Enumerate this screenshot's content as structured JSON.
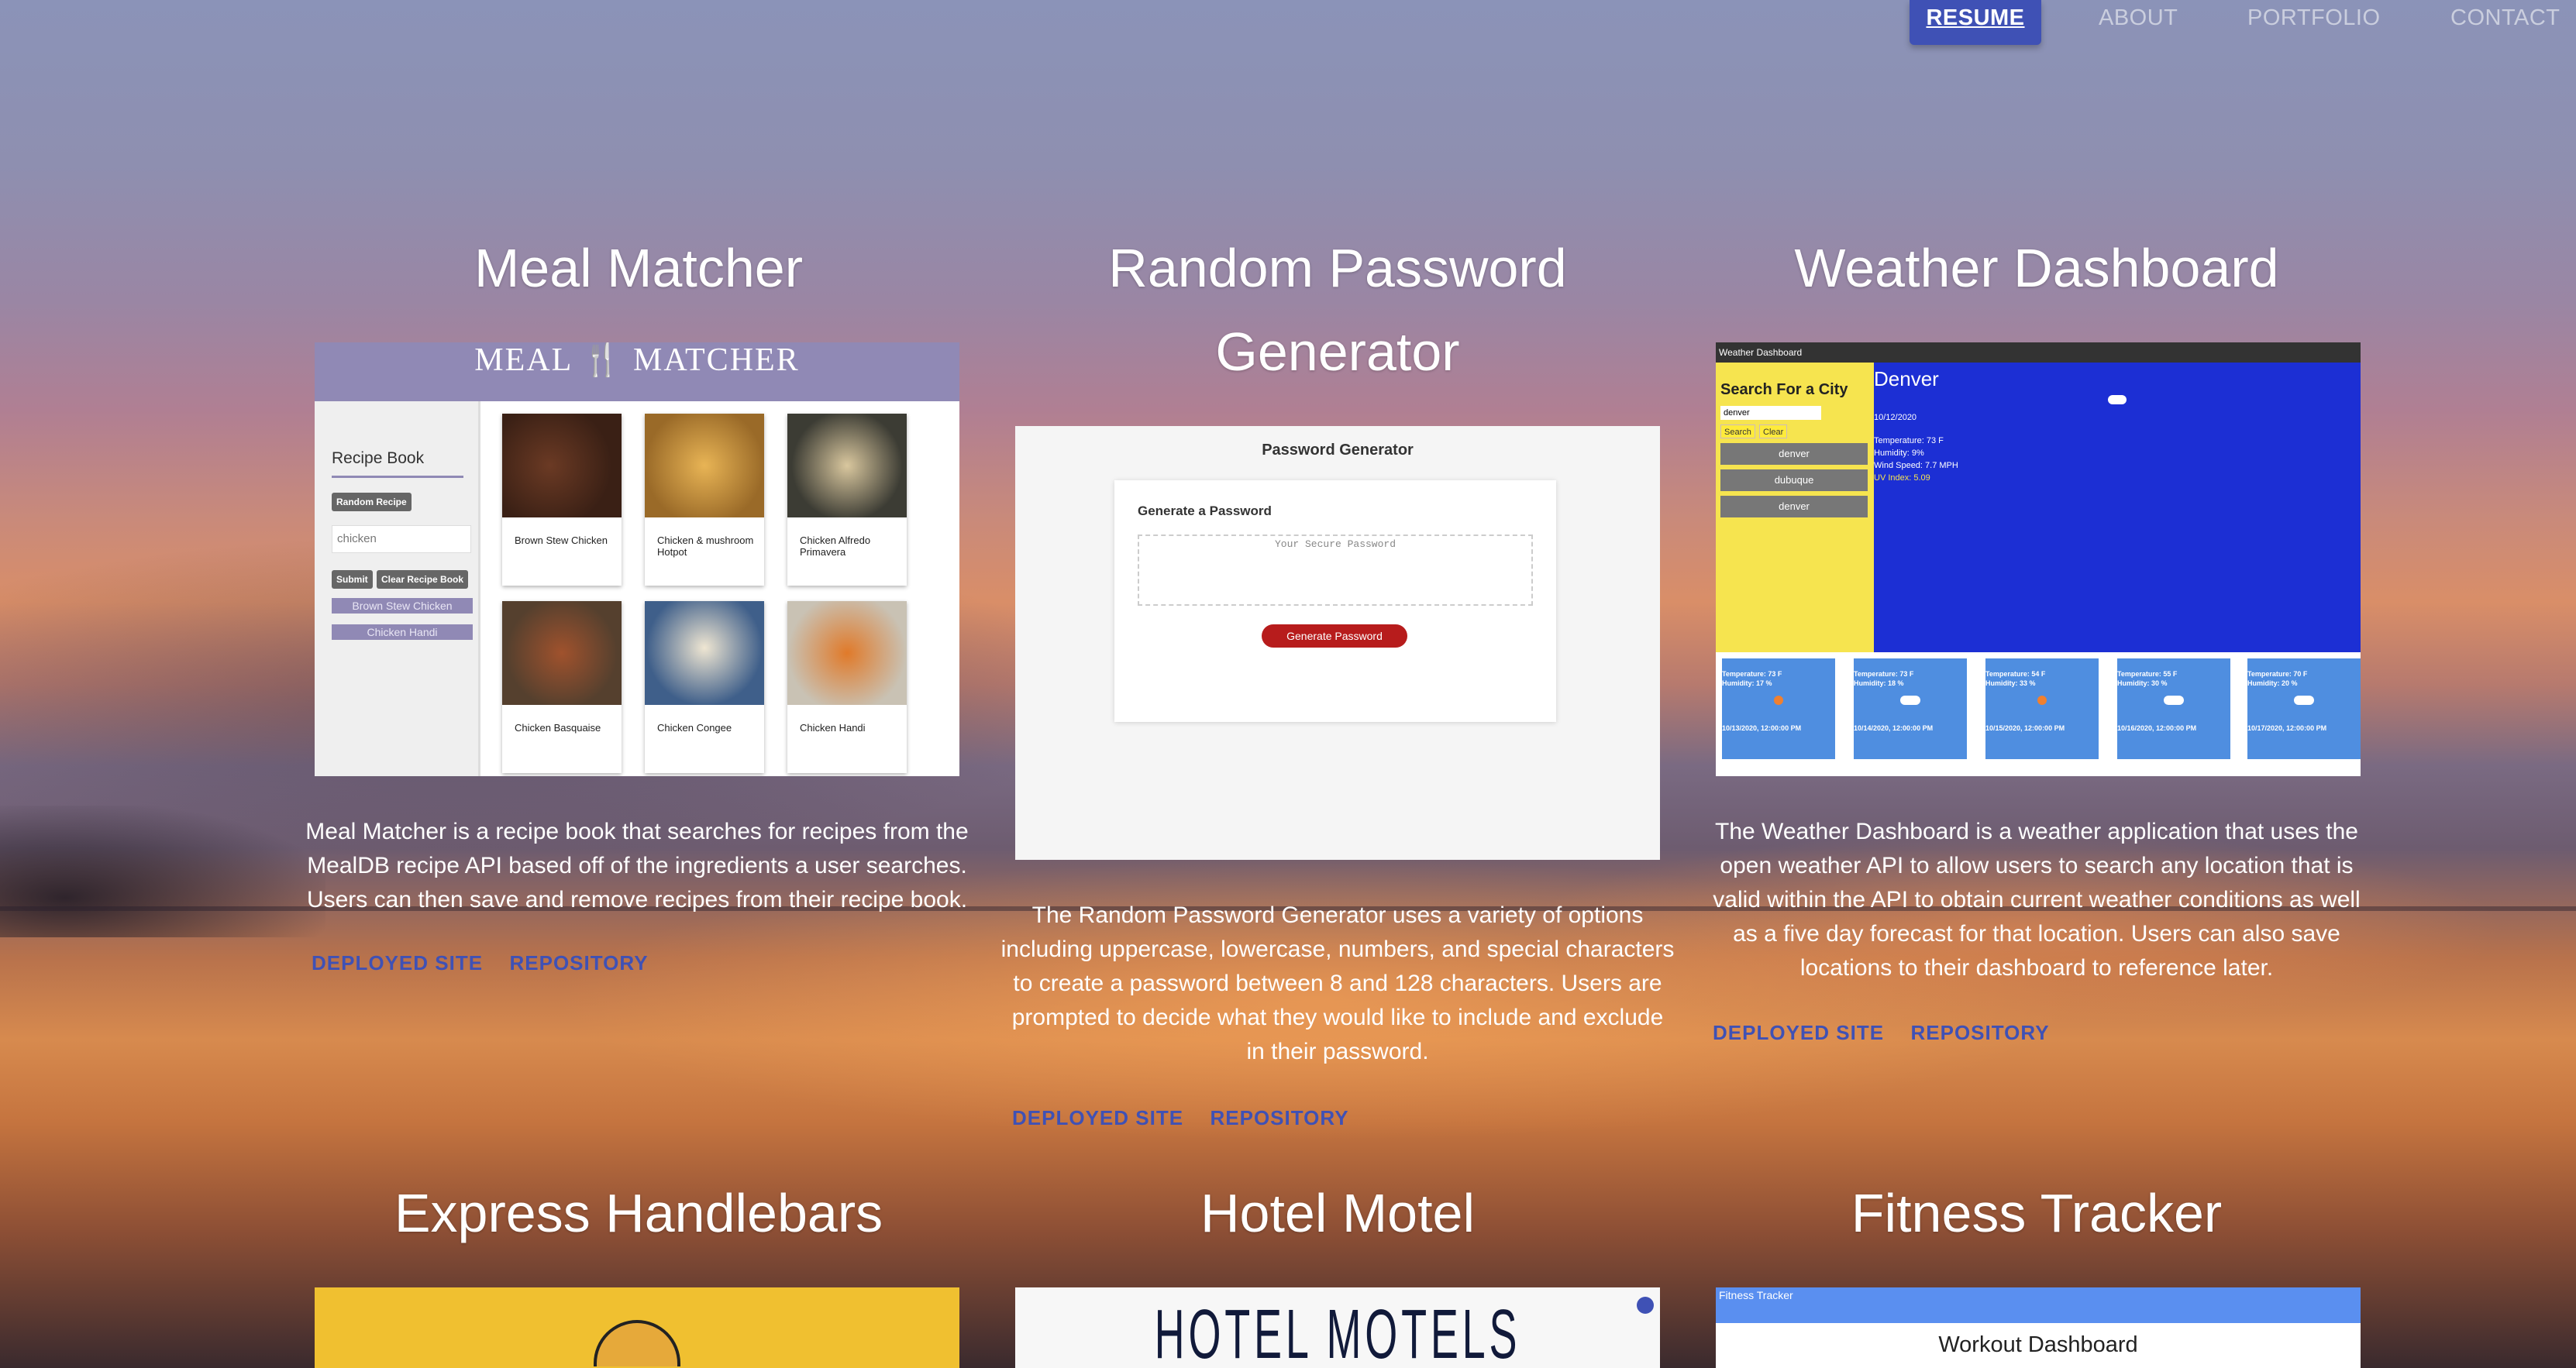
{
  "nav": {
    "resume": "RESUME",
    "about": "ABOUT",
    "portfolio": "PORTFOLIO",
    "contact": "CONTACT"
  },
  "links": {
    "deployed": "DEPLOYED SITE",
    "repository": "REPOSITORY"
  },
  "projects": [
    {
      "title": "Meal Matcher",
      "description": "Meal Matcher is a recipe book that searches for recipes from the MealDB recipe API based off of the ingredients a user searches. Users can then save and remove recipes from their recipe book.",
      "screenshot": {
        "header": "MEAL 🍴 MATCHER",
        "sidebar_title": "Recipe Book",
        "random_button": "Random Recipe",
        "search_value": "chicken",
        "submit_button": "Submit",
        "clear_button": "Clear Recipe Book",
        "saved": [
          "Brown Stew Chicken",
          "Chicken Handi"
        ],
        "recipes": [
          "Brown Stew Chicken",
          "Chicken & mushroom Hotpot",
          "Chicken Alfredo Primavera",
          "Chicken Basquaise",
          "Chicken Congee",
          "Chicken Handi"
        ]
      }
    },
    {
      "title": "Random Password Generator",
      "description": "The Random Password Generator uses a variety of options including uppercase, lowercase, numbers, and special characters to create a password between 8 and 128 characters. Users are prompted to decide what they would like to include and exclude in their password.",
      "screenshot": {
        "header": "Password Generator",
        "subheader": "Generate a Password",
        "placeholder": "Your Secure Password",
        "button": "Generate Password"
      }
    },
    {
      "title": "Weather Dashboard",
      "description": "The Weather Dashboard is a weather application that uses the open weather API to allow users to search any location that is valid within the API to obtain current weather conditions as well as a five day forecast for that location. Users can also save locations to their dashboard to reference later.",
      "screenshot": {
        "app_title": "Weather Dashboard",
        "search_label": "Search For a City",
        "search_value": "denver",
        "search_button": "Search",
        "clear_button": "Clear",
        "cities": [
          "denver",
          "dubuque",
          "denver"
        ],
        "city": "Denver",
        "date": "10/12/2020",
        "temperature": "Temperature: 73 F",
        "humidity": "Humidity: 9%",
        "wind": "Wind Speed: 7.7 MPH",
        "uv": "UV Index: 5.09",
        "forecast": [
          {
            "temp": "Temperature: 73 F",
            "humidity": "Humidity: 17 %",
            "date": "10/13/2020, 12:00:00 PM",
            "icon": "sun-icon"
          },
          {
            "temp": "Temperature: 73 F",
            "humidity": "Humidity: 18 %",
            "date": "10/14/2020, 12:00:00 PM",
            "icon": "cloud-icon"
          },
          {
            "temp": "Temperature: 54 F",
            "humidity": "Humidity: 33 %",
            "date": "10/15/2020, 12:00:00 PM",
            "icon": "sun-icon"
          },
          {
            "temp": "Temperature: 55 F",
            "humidity": "Humidity: 30 %",
            "date": "10/16/2020, 12:00:00 PM",
            "icon": "cloud-icon"
          },
          {
            "temp": "Temperature: 70 F",
            "humidity": "Humidity: 20 %",
            "date": "10/17/2020, 12:00:00 PM",
            "icon": "cloud-icon"
          }
        ]
      }
    },
    {
      "title": "Express Handlebars"
    },
    {
      "title": "Hotel Motel",
      "screenshot": {
        "header": "HOTEL MOTELS"
      }
    },
    {
      "title": "Fitness Tracker",
      "screenshot": {
        "bar": "Fitness Tracker",
        "header": "Workout Dashboard"
      }
    }
  ],
  "colors": {
    "accent": "#3f51b5",
    "meal_purple": "#9089b5",
    "weather_blue": "#1c2fd4",
    "weather_yellow": "#f6e44f",
    "password_red": "#b71c1c"
  }
}
